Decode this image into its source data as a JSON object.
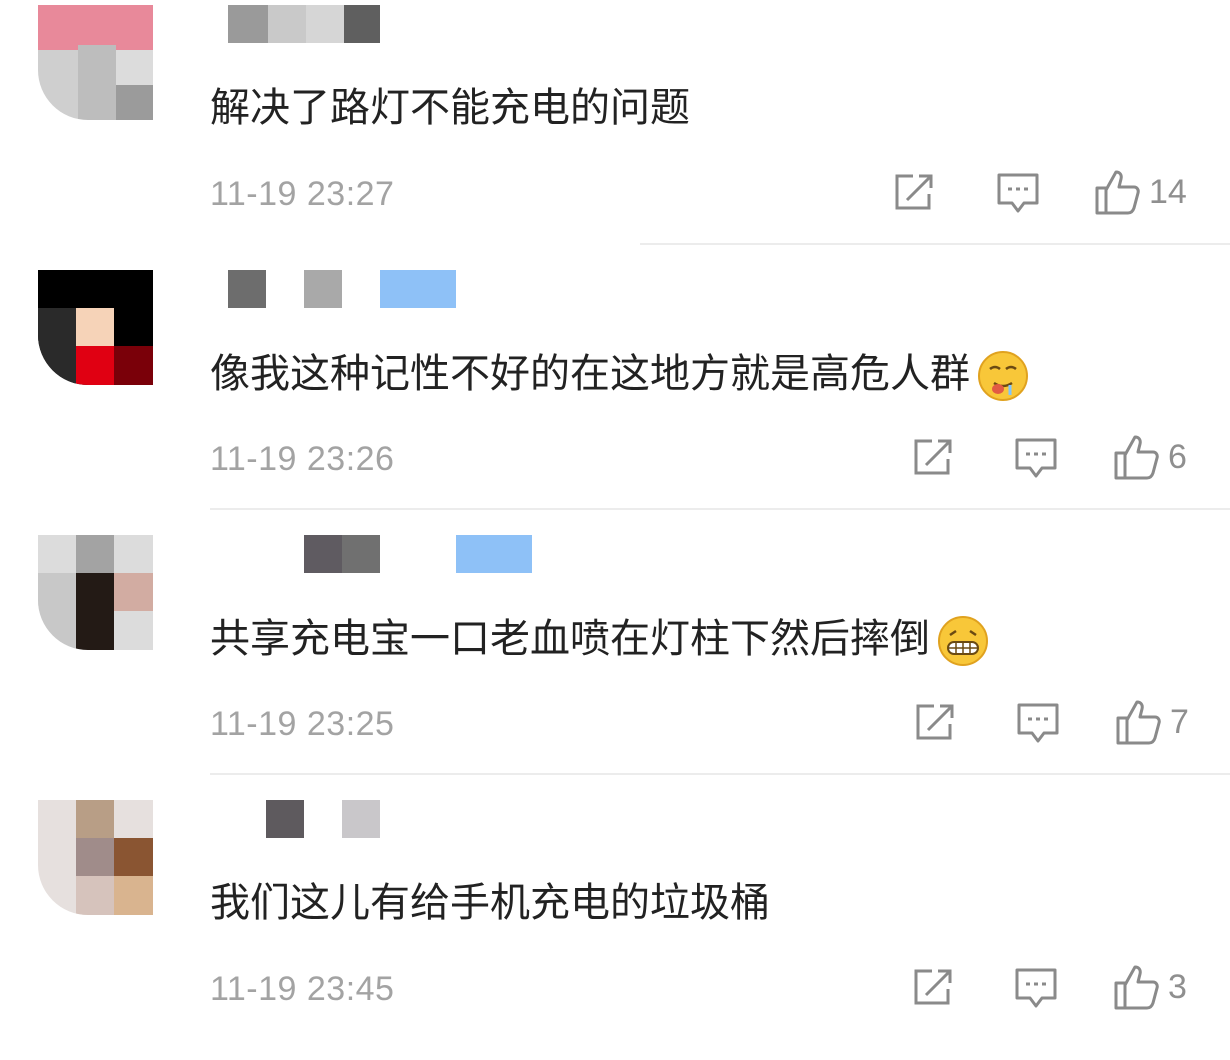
{
  "comments": [
    {
      "text": "解决了路灯不能充电的问题",
      "time": "11-19 23:27",
      "likes": "14",
      "emoji": null,
      "avatar_colors": [
        "#e8899a",
        "#bdbdbd",
        "#cfcfcf",
        "#9b9b9b"
      ],
      "name_blur_colors": [
        "#9a9a9a",
        "#c9c9c9",
        "#d6d6d6",
        "#5f5f5f"
      ]
    },
    {
      "text": "像我这种记性不好的在这地方就是高危人群",
      "time": "11-19 23:26",
      "likes": "6",
      "emoji": "drooling-face-icon",
      "avatar_colors": [
        "#000000",
        "#f6d3b8",
        "#e00012",
        "#7a0009"
      ],
      "name_blur_colors": [
        "#6d6d6d",
        "#a9a9a9",
        "#8ec1f7"
      ]
    },
    {
      "text": "共享充电宝一口老血喷在灯柱下然后摔倒",
      "time": "11-19 23:25",
      "likes": "7",
      "emoji": "grinning-face-icon",
      "avatar_colors": [
        "#a3a3a3",
        "#231a15",
        "#d2aca2",
        "#c8c8c8"
      ],
      "name_blur_colors": [
        "#5f5b61",
        "#707070",
        "#8ec1f7"
      ]
    },
    {
      "text": "我们这儿有给手机充电的垃圾桶",
      "time": "11-19 23:45",
      "likes": "3",
      "emoji": null,
      "avatar_colors": [
        "#b89e86",
        "#a08c8a",
        "#8a5532",
        "#d6c3bc"
      ],
      "name_blur_colors": [
        "#5e5a5e",
        "#c9c7ca"
      ]
    }
  ],
  "icons": {
    "share": "share-icon",
    "reply": "comment-icon",
    "like": "thumbs-up-icon"
  }
}
